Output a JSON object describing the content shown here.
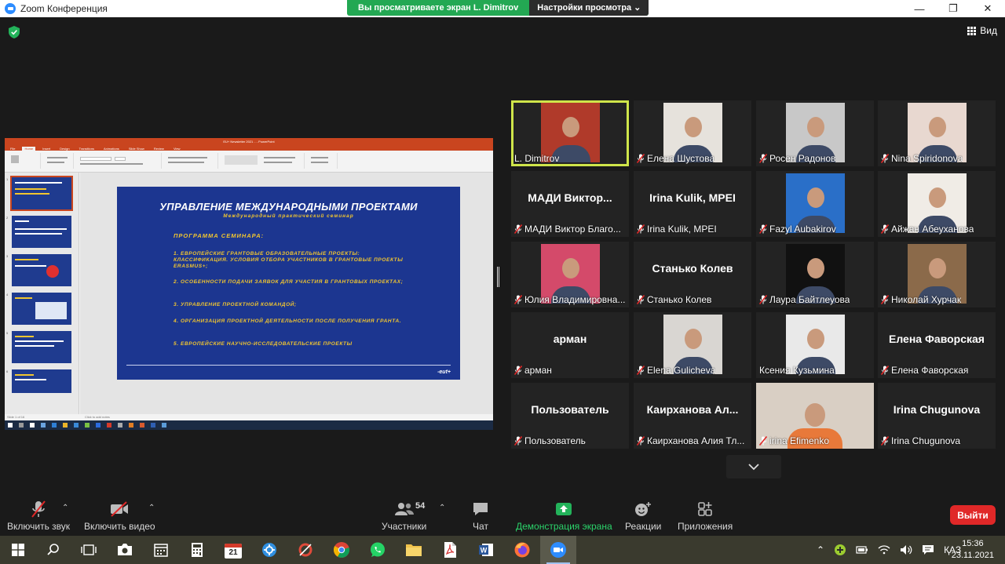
{
  "window": {
    "title": "Zoom Конференция",
    "minimize": "—",
    "maximize": "❐",
    "close": "✕"
  },
  "share_banner": {
    "message": "Вы просматриваете экран L. Dimitrov",
    "options": "Настройки просмотра ⌄"
  },
  "view_button": {
    "label": "Вид"
  },
  "shared_screen": {
    "ppt_title": "EU+ Newsletter 2021 ..   - PowerPoint",
    "tabs": [
      "File",
      "Home",
      "Insert",
      "Design",
      "Transitions",
      "Animations",
      "Slide Show",
      "Review",
      "View"
    ],
    "active_tab": "Home",
    "slide": {
      "title": "УПРАВЛЕНИЕ МЕЖДУНАРОДНЫМИ ПРОЕКТАМИ",
      "subtitle": "Международный практический семинар",
      "program_heading": "ПРОГРАММА СЕМИНАРА:",
      "items": [
        "1. ЕВРОПЕЙСКИЕ ГРАНТОВЫЕ ОБРАЗОВАТЕЛЬНЫЕ ПРОЕКТЫ: КЛАССИФИКАЦИЯ. УСЛОВИЯ ОТБОРА УЧАСТНИКОВ В ГРАНТОВЫЕ ПРОЕКТЫ ERASMUS+;",
        "2. ОСОБЕННОСТИ ПОДАЧИ ЗАЯВОК ДЛЯ УЧАСТИЯ В ГРАНТОВЫХ ПРОЕКТАХ;",
        "3. УПРАВЛЕНИЕ ПРОЕКТНОЙ КОМАНДОЙ;",
        "4. ОРГАНИЗАЦИЯ ПРОЕКТНОЙ ДЕЯТЕЛЬНОСТИ ПОСЛЕ ПОЛУЧЕНИЯ ГРАНТА.",
        "5. ЕВРОПЕЙСКИЕ НАУЧНО-ИССЛЕДОВАТЕЛЬСКИЕ ПРОЕКТЫ"
      ],
      "logo": "-eut+"
    },
    "notes_placeholder": "Click to add notes",
    "status": "Slide 1 of 16"
  },
  "participants": [
    {
      "name": "L. Dimitrov",
      "display": "",
      "muted": false,
      "active": true,
      "video": true,
      "photo_bg": "#b03a2a"
    },
    {
      "name": "Елена Шустова",
      "display": "",
      "muted": true,
      "active": false,
      "video": true,
      "photo_bg": "#e6e2dc"
    },
    {
      "name": "Росен Радонов",
      "display": "",
      "muted": true,
      "active": false,
      "video": true,
      "photo_bg": "#c8c8c8"
    },
    {
      "name": "Nina Spiridonova",
      "display": "",
      "muted": true,
      "active": false,
      "video": true,
      "photo_bg": "#e8d8d0"
    },
    {
      "name": "МАДИ Виктор Благо...",
      "display": "МАДИ  Виктор...",
      "muted": true,
      "active": false,
      "video": false
    },
    {
      "name": "Irina Kulik, MPEI",
      "display": "Irina Kulik, MPEI",
      "muted": true,
      "active": false,
      "video": false
    },
    {
      "name": "Fazyl Aubakirov",
      "display": "",
      "muted": true,
      "active": false,
      "video": true,
      "photo_bg": "#2a6fc8"
    },
    {
      "name": "Айжан Абеуханова",
      "display": "",
      "muted": true,
      "active": false,
      "video": true,
      "photo_bg": "#f0ece6"
    },
    {
      "name": "Юлия Владимировна...",
      "display": "",
      "muted": true,
      "active": false,
      "video": true,
      "photo_bg": "#d44a6a"
    },
    {
      "name": "Станько Колев",
      "display": "Станько Колев",
      "muted": true,
      "active": false,
      "video": false
    },
    {
      "name": "Лаура Байтлеуова",
      "display": "",
      "muted": true,
      "active": false,
      "video": true,
      "photo_bg": "#111111"
    },
    {
      "name": "Николай Хурчак",
      "display": "",
      "muted": true,
      "active": false,
      "video": true,
      "photo_bg": "#8b6a4a"
    },
    {
      "name": "арман",
      "display": "арман",
      "muted": true,
      "active": false,
      "video": false
    },
    {
      "name": "Elena Gulicheva",
      "display": "",
      "muted": true,
      "active": false,
      "video": true,
      "photo_bg": "#d9d6d2"
    },
    {
      "name": "Ксения Кузьмина",
      "display": "",
      "muted": false,
      "active": false,
      "video": true,
      "photo_bg": "#e9e9e9"
    },
    {
      "name": "Елена Фаворская",
      "display": "Елена Фаворская",
      "muted": true,
      "active": false,
      "video": false
    },
    {
      "name": "Пользователь",
      "display": "Пользователь",
      "muted": true,
      "active": false,
      "video": false
    },
    {
      "name": "Каирханова Алия Тл...",
      "display": "Каирханова  Ал...",
      "muted": true,
      "active": false,
      "video": false
    },
    {
      "name": "irina Efimenko",
      "display": "",
      "muted": true,
      "active": false,
      "video": true,
      "photo_bg": "#d9cfc4",
      "wide": true
    },
    {
      "name": "Irina Chugunova",
      "display": "Irina Chugunova",
      "muted": true,
      "active": false,
      "video": false
    }
  ],
  "toolbar": {
    "audio": "Включить звук",
    "video": "Включить видео",
    "participants": "Участники",
    "participants_count": "54",
    "chat": "Чат",
    "share": "Демонстрация экрана",
    "reactions": "Реакции",
    "apps": "Приложения",
    "leave": "Выйти"
  },
  "taskbar": {
    "lang": "ҚАЗ",
    "time": "15:36",
    "date": "23.11.2021",
    "calendar_day": "21"
  },
  "colors": {
    "accent_green": "#23a853",
    "active_speaker": "#cfe54a",
    "leave_red": "#e02828",
    "slide_blue": "#1c3690",
    "slide_yellow": "#f2c62f"
  }
}
